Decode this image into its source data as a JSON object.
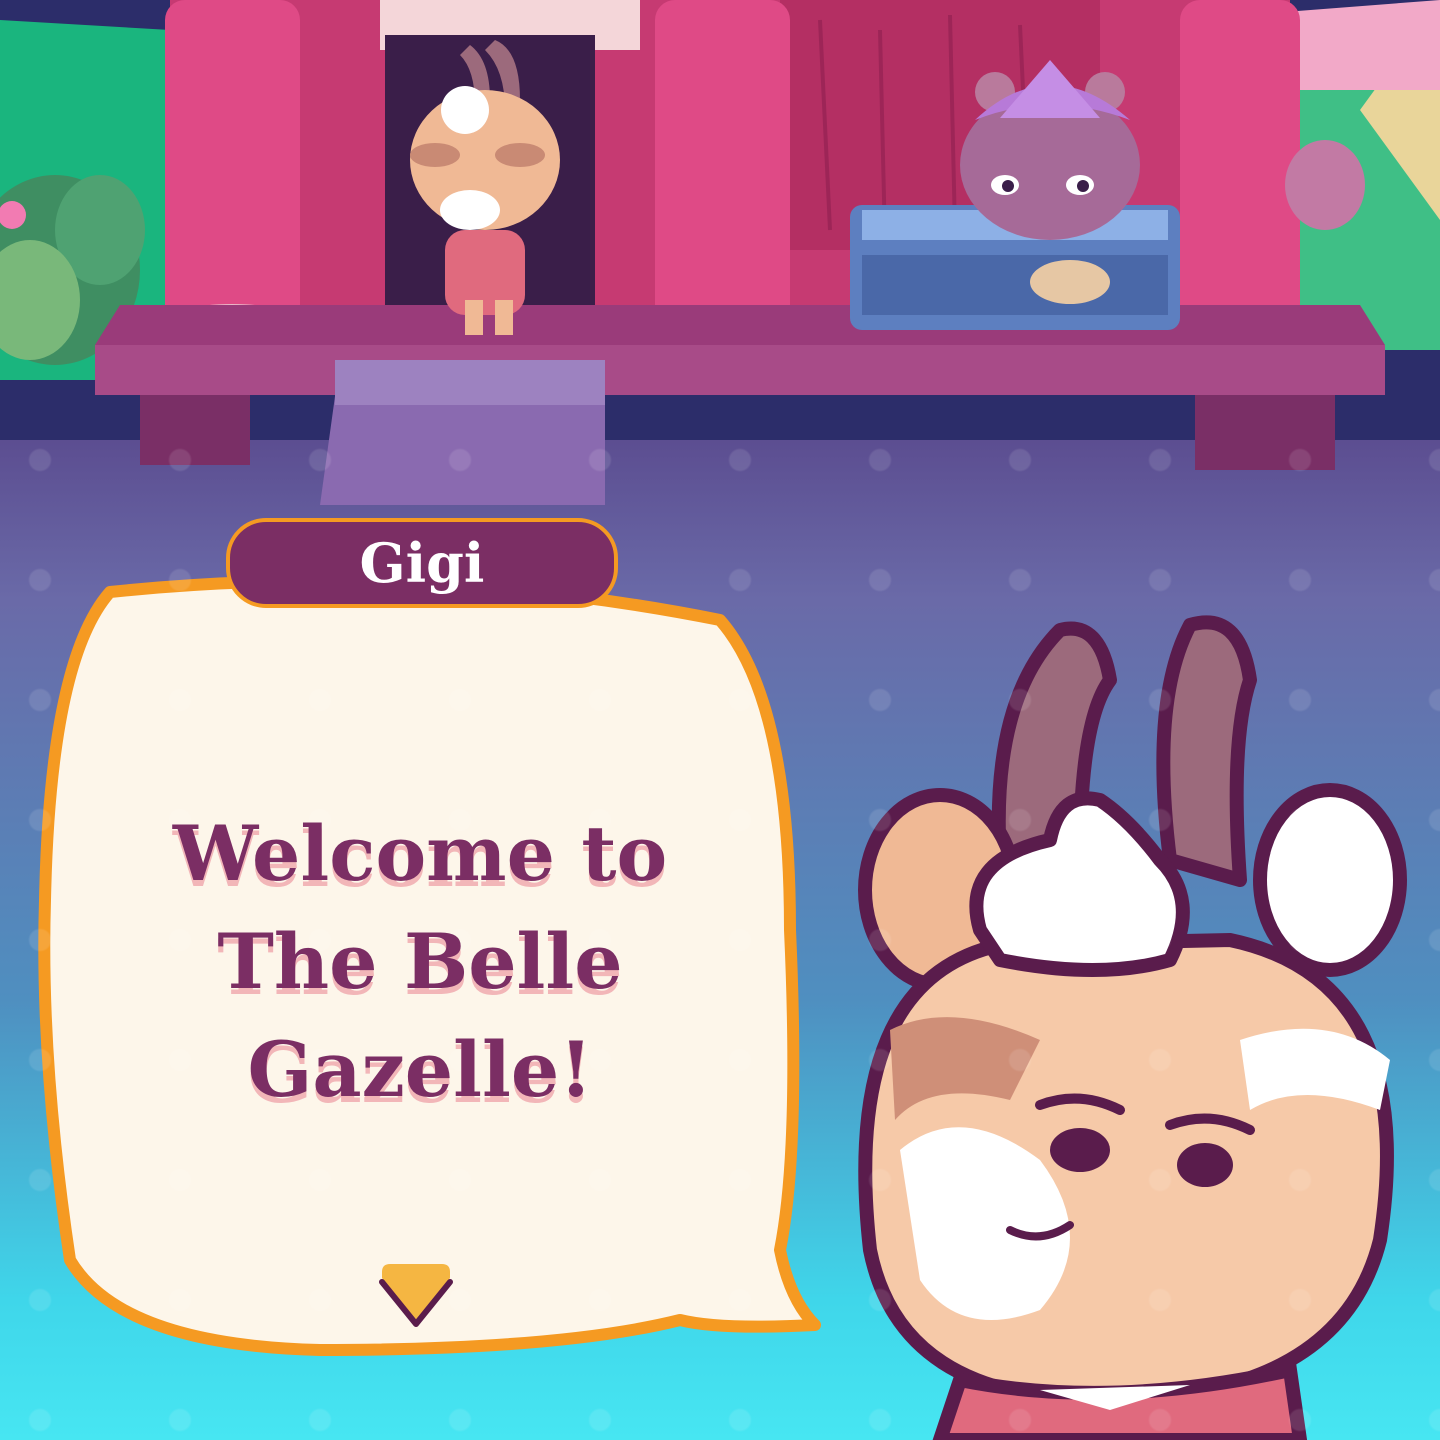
{
  "dialog": {
    "speaker": "Gigi",
    "text": "Welcome to The Belle Gazelle!",
    "next_icon": "chevron-down-icon"
  },
  "colors": {
    "bubble_fill": "#fdf6ea",
    "bubble_border": "#f59a22",
    "nameplate": "#7b2e64",
    "text": "#7b2e64",
    "arrow": "#f5b642"
  }
}
